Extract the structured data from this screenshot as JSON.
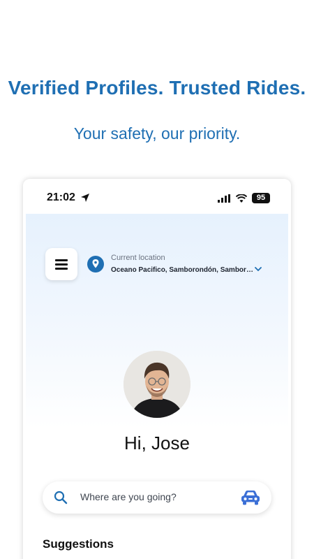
{
  "promo": {
    "headline": "Verified Profiles. Trusted Rides.",
    "tagline": "Your safety, our priority."
  },
  "statusbar": {
    "time": "21:02",
    "battery": "95"
  },
  "location": {
    "label": "Current location",
    "value": "Oceano Pacifico, Samborondón, Samboron…"
  },
  "user": {
    "greeting": "Hi, Jose"
  },
  "search": {
    "placeholder": "Where are you going?"
  },
  "sections": {
    "suggestions": "Suggestions"
  },
  "colors": {
    "brand": "#1f6fb3",
    "pin": "#1f6fb3",
    "car": "#3b6fd6"
  }
}
